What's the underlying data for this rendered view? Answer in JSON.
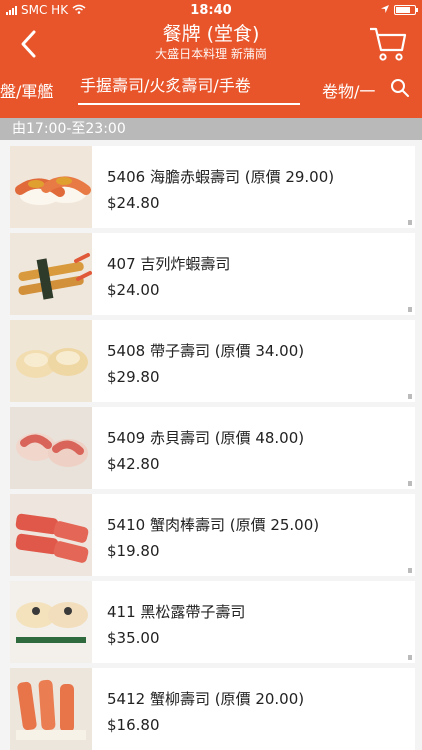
{
  "status": {
    "carrier": "SMC HK",
    "time": "18:40"
  },
  "header": {
    "title": "餐牌 (堂食)",
    "subtitle": "大盛日本料理 新蒲崗"
  },
  "tabs": {
    "left": "盤/軍艦",
    "active": "手握壽司/火炙壽司/手卷",
    "right": "卷物/一"
  },
  "time_range": "由17:00-至23:00",
  "items": [
    {
      "name": "5406 海膽赤蝦壽司 (原價 29.00)",
      "price": "$24.80"
    },
    {
      "name": "407 吉列炸蝦壽司",
      "price": "$24.00"
    },
    {
      "name": "5408 帶子壽司 (原價 34.00)",
      "price": "$29.80"
    },
    {
      "name": "5409 赤貝壽司 (原價 48.00)",
      "price": "$42.80"
    },
    {
      "name": "5410 蟹肉棒壽司 (原價 25.00)",
      "price": "$19.80"
    },
    {
      "name": "411 黑松露帶子壽司",
      "price": "$35.00"
    },
    {
      "name": "5412 蟹柳壽司 (原價 20.00)",
      "price": "$16.80"
    }
  ],
  "colors": {
    "header": "#e8552a",
    "timebar": "#b9b9b9"
  }
}
